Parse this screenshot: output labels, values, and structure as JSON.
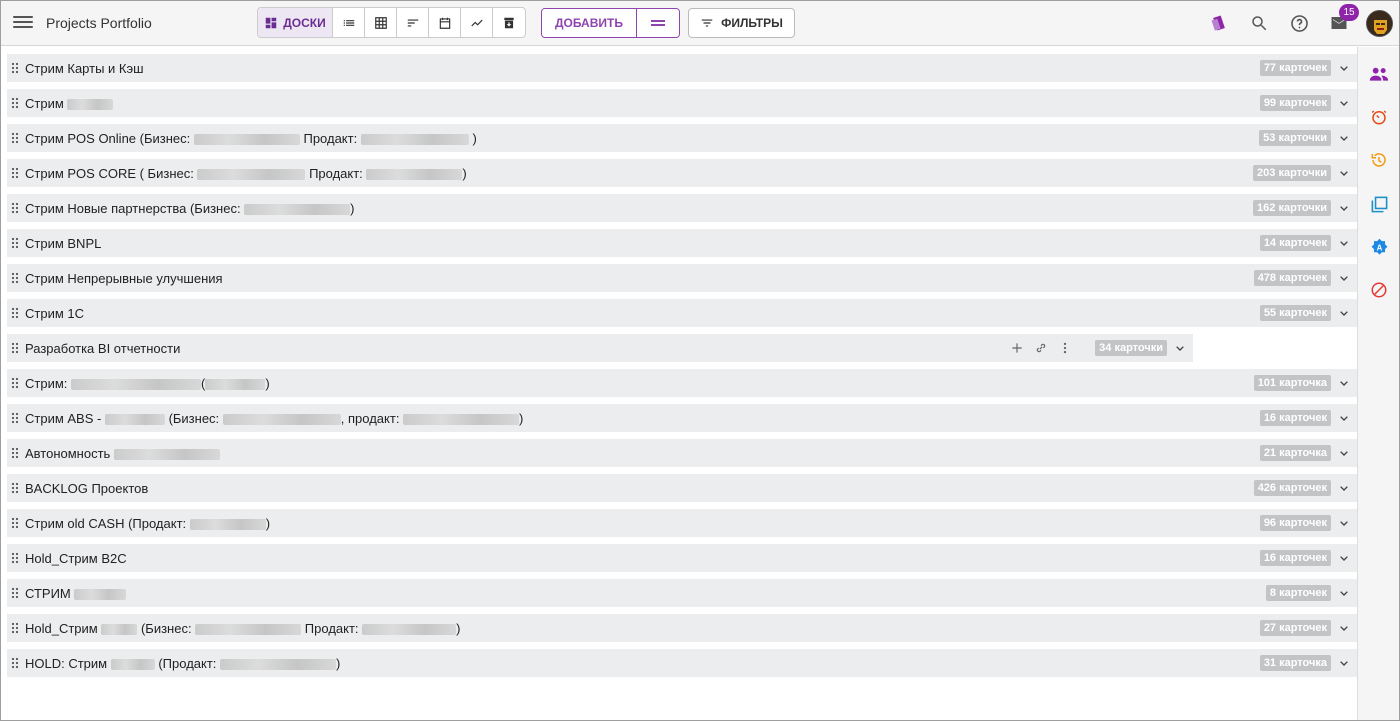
{
  "header": {
    "app_title": "Projects Portfolio",
    "views": [
      {
        "name": "boards",
        "label": "ДОСКИ",
        "icon": "dashboard-icon",
        "active": true
      },
      {
        "name": "list",
        "icon": "list-icon"
      },
      {
        "name": "table",
        "icon": "grid-icon"
      },
      {
        "name": "sort",
        "icon": "sort-icon"
      },
      {
        "name": "calendar",
        "icon": "calendar-icon"
      },
      {
        "name": "chart",
        "icon": "trend-icon"
      },
      {
        "name": "archive",
        "icon": "archive-icon"
      }
    ],
    "add_label": "ДОБАВИТЬ",
    "filters_label": "ФИЛЬТРЫ",
    "notifications_count": "15",
    "accent": "#8e44ad"
  },
  "rows": [
    {
      "title": "Стрим Карты и Кэш",
      "blurs": [],
      "suffix": "",
      "count": "77 карточек"
    },
    {
      "title": "Стрим ",
      "blurs": [
        46
      ],
      "suffix": "",
      "count": "99 карточек"
    },
    {
      "title": "Стрим POS Online (Бизнес: ",
      "blurs": [
        106
      ],
      "mid": " Продакт: ",
      "blurs2": [
        108
      ],
      "suffix": " )",
      "count": "53 карточки"
    },
    {
      "title": "Стрим POS CORE ( Бизнес: ",
      "blurs": [
        108
      ],
      "mid": " Продакт: ",
      "blurs2": [
        96
      ],
      "suffix": ")",
      "count": "203 карточки"
    },
    {
      "title": "Стрим Новые партнерства (Бизнес: ",
      "blurs": [
        106
      ],
      "suffix": ")",
      "count": "162 карточки"
    },
    {
      "title": "Стрим BNPL",
      "blurs": [],
      "suffix": "",
      "count": "14 карточек"
    },
    {
      "title": "Стрим Непрерывные улучшения",
      "blurs": [],
      "suffix": "",
      "count": "478 карточек"
    },
    {
      "title": "Стрим 1С",
      "blurs": [],
      "suffix": "",
      "count": "55 карточек"
    },
    {
      "title": "Разработка BI отчетности",
      "blurs": [],
      "suffix": "",
      "count": "34 карточки",
      "hover": true
    },
    {
      "title": "Стрим: ",
      "blurs": [
        130
      ],
      "mid": "(",
      "blurs2": [
        60
      ],
      "suffix": ")",
      "count": "101 карточка"
    },
    {
      "title": "Стрим ABS - ",
      "blurs": [
        60
      ],
      "mid": " (Бизнес: ",
      "blurs2": [
        118
      ],
      "mid2": ", продакт: ",
      "blurs3": [
        116
      ],
      "suffix": ")",
      "count": "16 карточек"
    },
    {
      "title": "Автономность ",
      "blurs": [
        106
      ],
      "suffix": "",
      "count": "21 карточка"
    },
    {
      "title": "BACKLOG Проектов",
      "blurs": [],
      "suffix": "",
      "count": "426 карточек"
    },
    {
      "title": "Стрим old CASH (Продакт: ",
      "blurs": [
        76
      ],
      "suffix": ")",
      "count": "96 карточек"
    },
    {
      "title": "Hold_Стрим B2C",
      "blurs": [],
      "suffix": "",
      "count": "16 карточек"
    },
    {
      "title": "СТРИМ ",
      "blurs": [
        52
      ],
      "suffix": "",
      "count": "8 карточек"
    },
    {
      "title": "Hold_Стрим ",
      "blurs": [
        36
      ],
      "mid": " (Бизнес: ",
      "blurs2": [
        106
      ],
      "mid2": " Продакт: ",
      "blurs3": [
        94
      ],
      "suffix": ")",
      "count": "27 карточек"
    },
    {
      "title": "HOLD: Стрим ",
      "blurs": [
        44
      ],
      "mid": " (Продакт: ",
      "blurs2": [
        116
      ],
      "suffix": ")",
      "count": "31 карточка"
    }
  ],
  "sidebar": {
    "icons": [
      "people-icon",
      "timer-icon",
      "history-icon",
      "layers-icon",
      "auto-badge-icon",
      "blocked-icon"
    ]
  }
}
